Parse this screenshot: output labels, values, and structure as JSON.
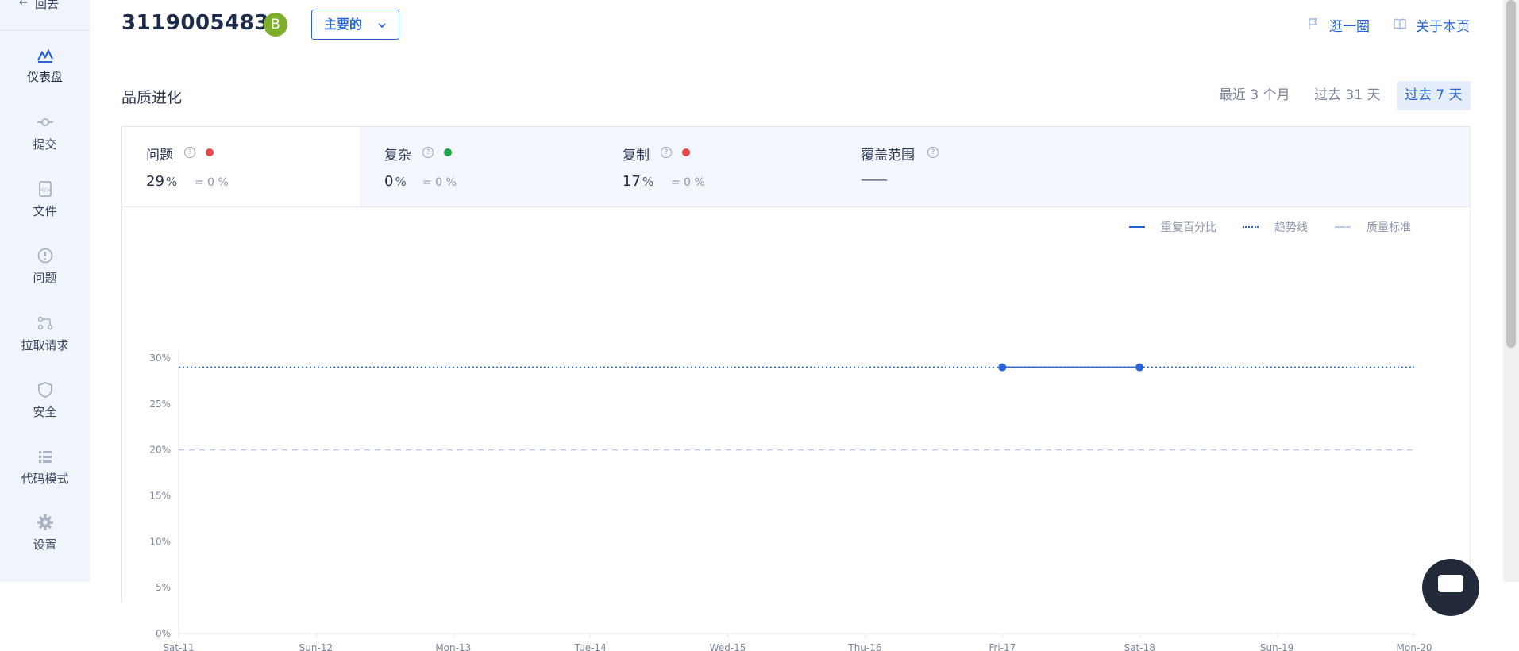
{
  "sidebar": {
    "back_label": "回去",
    "items": [
      {
        "label": "仪表盘",
        "icon": "dashboard-icon",
        "active": true
      },
      {
        "label": "提交",
        "icon": "commit-icon"
      },
      {
        "label": "文件",
        "icon": "file-icon"
      },
      {
        "label": "问题",
        "icon": "issue-icon"
      },
      {
        "label": "拉取请求",
        "icon": "pull-request-icon"
      },
      {
        "label": "安全",
        "icon": "shield-icon"
      },
      {
        "label": "代码模式",
        "icon": "list-icon"
      },
      {
        "label": "设置",
        "icon": "gear-icon"
      }
    ]
  },
  "header": {
    "project_key": "3119005483",
    "grade": "B",
    "branch": "主要的",
    "tour_label": "逛一圈",
    "about_label": "关于本页"
  },
  "section": {
    "title": "品质进化",
    "periods": [
      "最近 3 个月",
      "过去 31 天",
      "过去 7 天"
    ],
    "active_period": 2
  },
  "metrics": [
    {
      "name": "问题",
      "value": "29",
      "unit": "%",
      "compare": "=  0 %",
      "status_color": "#e5484d"
    },
    {
      "name": "复杂",
      "value": "0",
      "unit": "%",
      "compare": "=  0 %",
      "status_color": "#1fa34a"
    },
    {
      "name": "复制",
      "value": "17",
      "unit": "%",
      "compare": "=  0 %",
      "status_color": "#e5484d"
    },
    {
      "name": "覆盖范围",
      "value": "——",
      "unit": "",
      "compare": ""
    }
  ],
  "legend": [
    "重复百分比",
    "趋势线",
    "质量标准"
  ],
  "colors": {
    "accent": "#2563d6",
    "grid": "#e3e8f0"
  },
  "chart_data": {
    "type": "line",
    "categories": [
      "Sat-11",
      "Sun-12",
      "Mon-13",
      "Tue-14",
      "Wed-15",
      "Thu-16",
      "Fri-17",
      "Sat-18",
      "Sun-19",
      "Mon-20"
    ],
    "y_ticks": [
      "0%",
      "5%",
      "10%",
      "15%",
      "20%",
      "25%",
      "30%"
    ],
    "ylim": [
      0,
      30
    ],
    "series": [
      {
        "name": "重复百分比",
        "values": [
          null,
          null,
          null,
          null,
          null,
          null,
          29,
          29,
          null,
          null
        ],
        "style": "solid"
      },
      {
        "name": "趋势线",
        "values": [
          29,
          29,
          29,
          29,
          29,
          29,
          29,
          29,
          29,
          29
        ],
        "style": "dotted"
      },
      {
        "name": "质量标准",
        "values": [
          20,
          20,
          20,
          20,
          20,
          20,
          20,
          20,
          20,
          20
        ],
        "style": "dashed"
      }
    ]
  }
}
